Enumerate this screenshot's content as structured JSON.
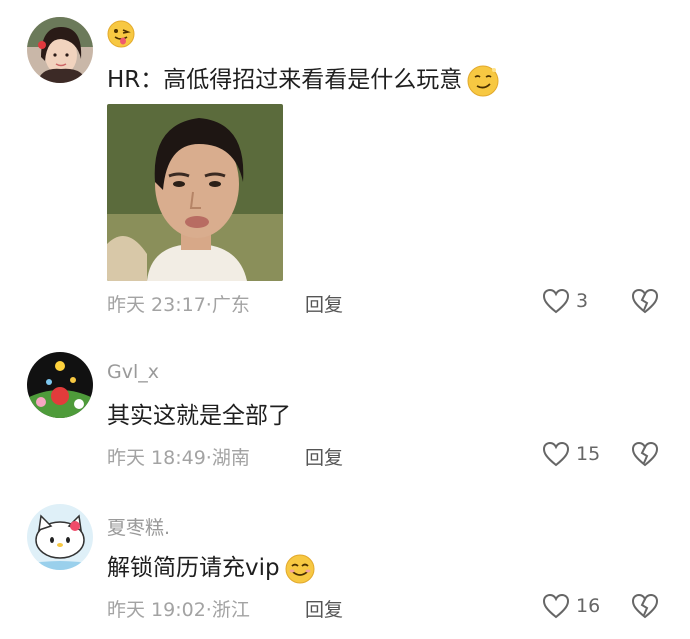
{
  "comments": [
    {
      "username": "",
      "text": "HR：高低得招过来看看是什么玩意",
      "time": "昨天 23:17",
      "location": "广东",
      "reply_label": "回复",
      "likes": "3",
      "avatar_icon": "avatar-woman-photo",
      "top_emoji_icon": "tongue-out-emoji-icon",
      "trail_emoji_icon": "smirk-emoji-icon",
      "has_image": true
    },
    {
      "username": "Gvl_x",
      "text": "其实这就是全部了",
      "time": "昨天 18:49",
      "location": "湖南",
      "reply_label": "回复",
      "likes": "15",
      "avatar_icon": "avatar-cartoon-garden"
    },
    {
      "username": "夏枣糕.",
      "text": "解锁简历请充vip",
      "time": "昨天 19:02",
      "location": "浙江",
      "reply_label": "回复",
      "likes": "16",
      "avatar_icon": "avatar-hello-kitty",
      "trail_emoji_icon": "smile-emoji-icon"
    }
  ],
  "meta_separator": "·",
  "colors": {
    "text": "#1f1f1f",
    "meta": "#a3a3a3",
    "username": "#9a9a9a",
    "emoji": "#f7c842"
  }
}
